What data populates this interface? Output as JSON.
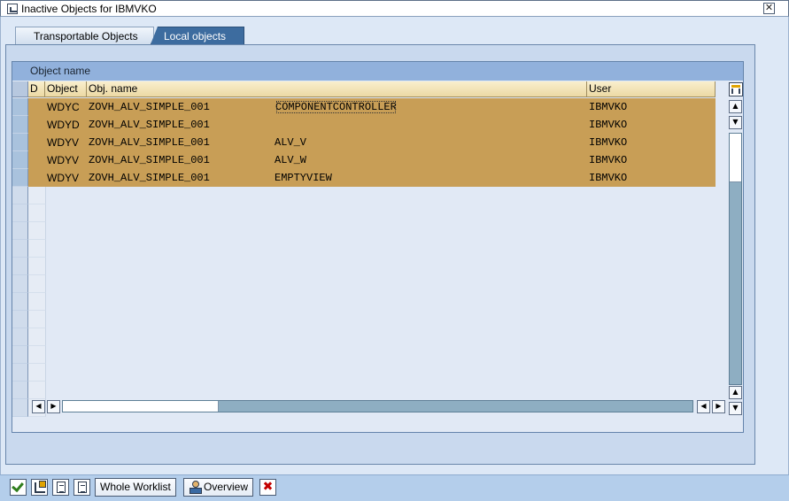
{
  "window": {
    "title": "Inactive Objects for IBMVKO",
    "close_glyph": "✕"
  },
  "tabs": [
    {
      "label": "Transportable Objects",
      "active": false
    },
    {
      "label": "Local objects",
      "active": true
    }
  ],
  "grid": {
    "title": "Object name",
    "columns": [
      "D",
      "Object",
      "Obj. name",
      "",
      "User"
    ],
    "rows": [
      {
        "d": "",
        "object": "WDYC",
        "obj_name": "ZOVH_ALV_SIMPLE_001",
        "sub_name": "COMPONENTCONTROLLER",
        "user": "IBMVKO"
      },
      {
        "d": "",
        "object": "WDYD",
        "obj_name": "ZOVH_ALV_SIMPLE_001",
        "sub_name": "",
        "user": "IBMVKO"
      },
      {
        "d": "",
        "object": "WDYV",
        "obj_name": "ZOVH_ALV_SIMPLE_001",
        "sub_name": "ALV_V",
        "user": "IBMVKO"
      },
      {
        "d": "",
        "object": "WDYV",
        "obj_name": "ZOVH_ALV_SIMPLE_001",
        "sub_name": "ALV_W",
        "user": "IBMVKO"
      },
      {
        "d": "",
        "object": "WDYV",
        "obj_name": "ZOVH_ALV_SIMPLE_001",
        "sub_name": "EMPTYVIEW",
        "user": "IBMVKO"
      }
    ],
    "empty_rows": 13,
    "scroll": {
      "up_glyph": "▲",
      "down_glyph": "▼",
      "left_glyph": "◀",
      "right_glyph": "▶"
    }
  },
  "toolbar": {
    "icons": [
      "check-icon",
      "hierarchy-icon",
      "select-icon",
      "detail-icon"
    ],
    "whole_worklist_label": "Whole Worklist",
    "overview_label": "Overview",
    "cancel_glyph": "✖"
  },
  "colors": {
    "row_highlight": "#c89e56",
    "tab_active": "#3d6c9f",
    "grid_title": "#91b1dc"
  }
}
